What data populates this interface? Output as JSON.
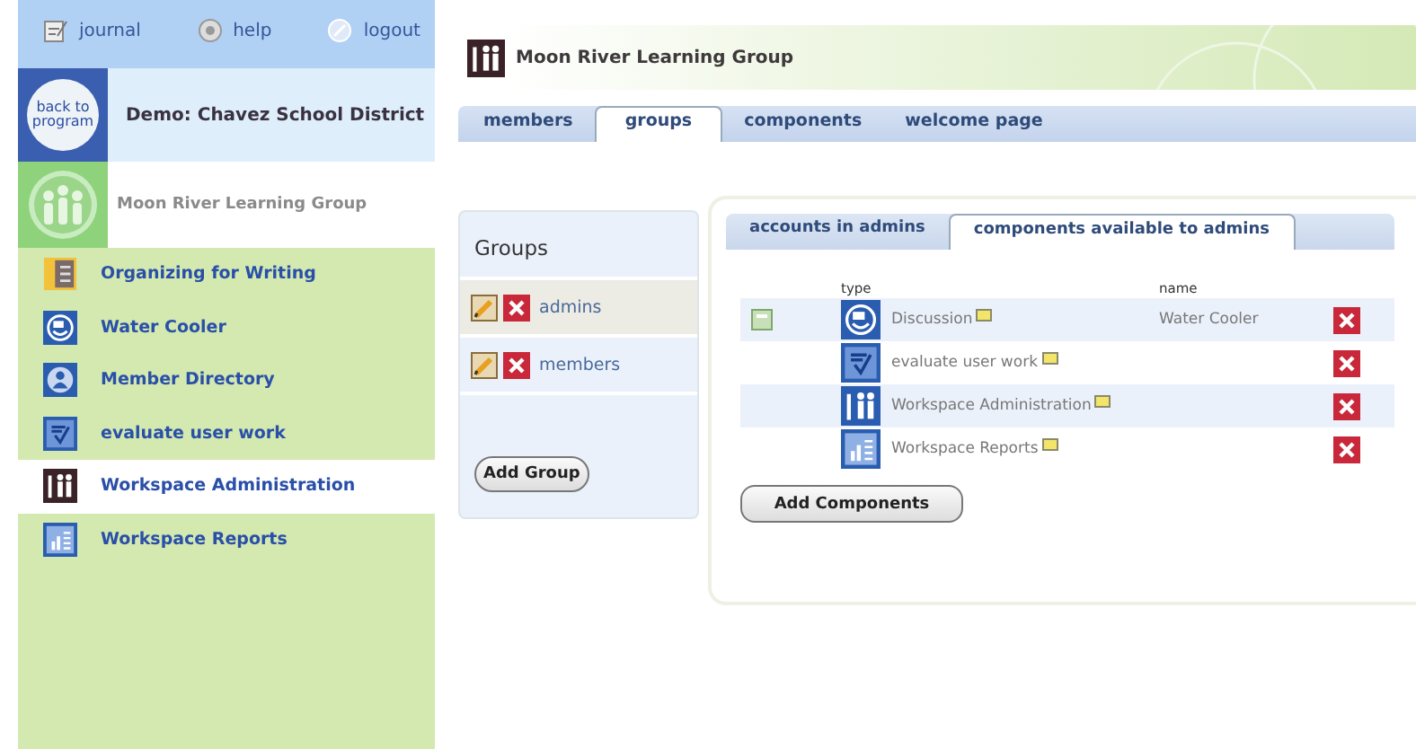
{
  "top_links": [
    {
      "label": "journal",
      "kind": "journal"
    },
    {
      "label": "help",
      "kind": "help"
    },
    {
      "label": "logout",
      "kind": "logout"
    }
  ],
  "program": {
    "badge": "back to program",
    "title": "Demo: Chavez School District"
  },
  "group": {
    "title": "Moon River Learning Group"
  },
  "sidebar": {
    "items": [
      {
        "label": "Organizing for Writing",
        "kind": "notebook",
        "selected": false
      },
      {
        "label": "Water Cooler",
        "kind": "discussion",
        "selected": false
      },
      {
        "label": "Member Directory",
        "kind": "person",
        "selected": false
      },
      {
        "label": "evaluate user work",
        "kind": "check",
        "selected": false
      },
      {
        "label": "Workspace Administration",
        "kind": "admin",
        "selected": true
      },
      {
        "label": "Workspace Reports",
        "kind": "reports",
        "selected": false
      }
    ]
  },
  "header": {
    "title": "Moon River Learning Group"
  },
  "tabs": [
    {
      "label": "members",
      "selected": false
    },
    {
      "label": "groups",
      "selected": true
    },
    {
      "label": "components",
      "selected": false
    },
    {
      "label": "welcome page",
      "selected": false
    }
  ],
  "groups_panel": {
    "title": "Groups",
    "groups": [
      {
        "name": "admins",
        "selected": true
      },
      {
        "name": "members",
        "selected": false
      }
    ],
    "add_button": "Add Group"
  },
  "detail": {
    "tabs": [
      {
        "label": "accounts in admins",
        "selected": false
      },
      {
        "label": "components available to admins",
        "selected": true
      }
    ],
    "columns": [
      "type",
      "name"
    ],
    "rows": [
      {
        "type": "Discussion",
        "kind": "discussion",
        "name": "Water Cooler",
        "locked": true
      },
      {
        "type": "evaluate user work",
        "kind": "check",
        "locked": false
      },
      {
        "type": "Workspace Administration",
        "kind": "admin",
        "locked": false
      },
      {
        "type": "Workspace Reports",
        "kind": "reports",
        "locked": false
      }
    ],
    "add_button": "Add Components"
  }
}
